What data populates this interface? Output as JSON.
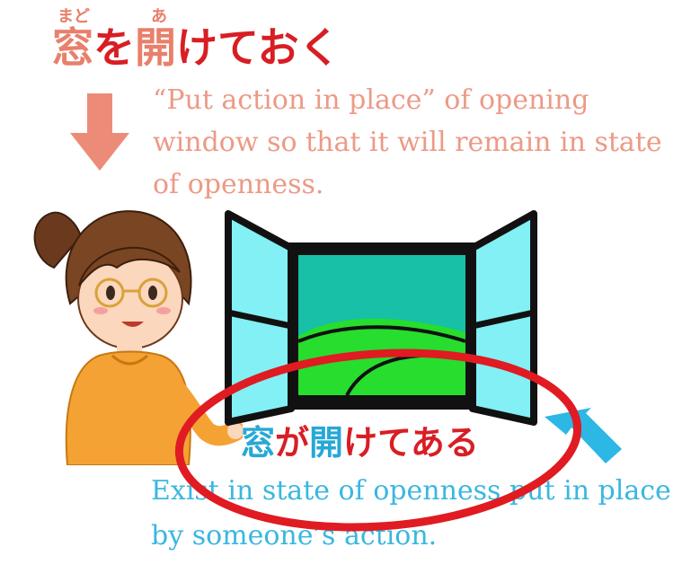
{
  "top": {
    "ruby_mado": "まど",
    "ruby_a": "あ",
    "heading_kanji_1": "窓",
    "heading_kana_1": "を",
    "heading_kanji_2": "開",
    "heading_kana_2": "けておく",
    "description": "“Put action in place” of opening window so that it will remain in state of openness."
  },
  "bottom": {
    "heading_kanji_1": "窓",
    "heading_kana_1": "が",
    "heading_kanji_2": "開",
    "heading_kana_2": "けてある",
    "description": "Exist in state of openness put in place by someone’s action."
  },
  "colors": {
    "accent_red": "#d81e24",
    "accent_salmon": "#e8806c",
    "accent_blue": "#27a8d6"
  },
  "icons": [
    "down-arrow-icon",
    "window-illustration",
    "woman-illustration",
    "up-arrow-icon",
    "red-circle-highlight"
  ]
}
